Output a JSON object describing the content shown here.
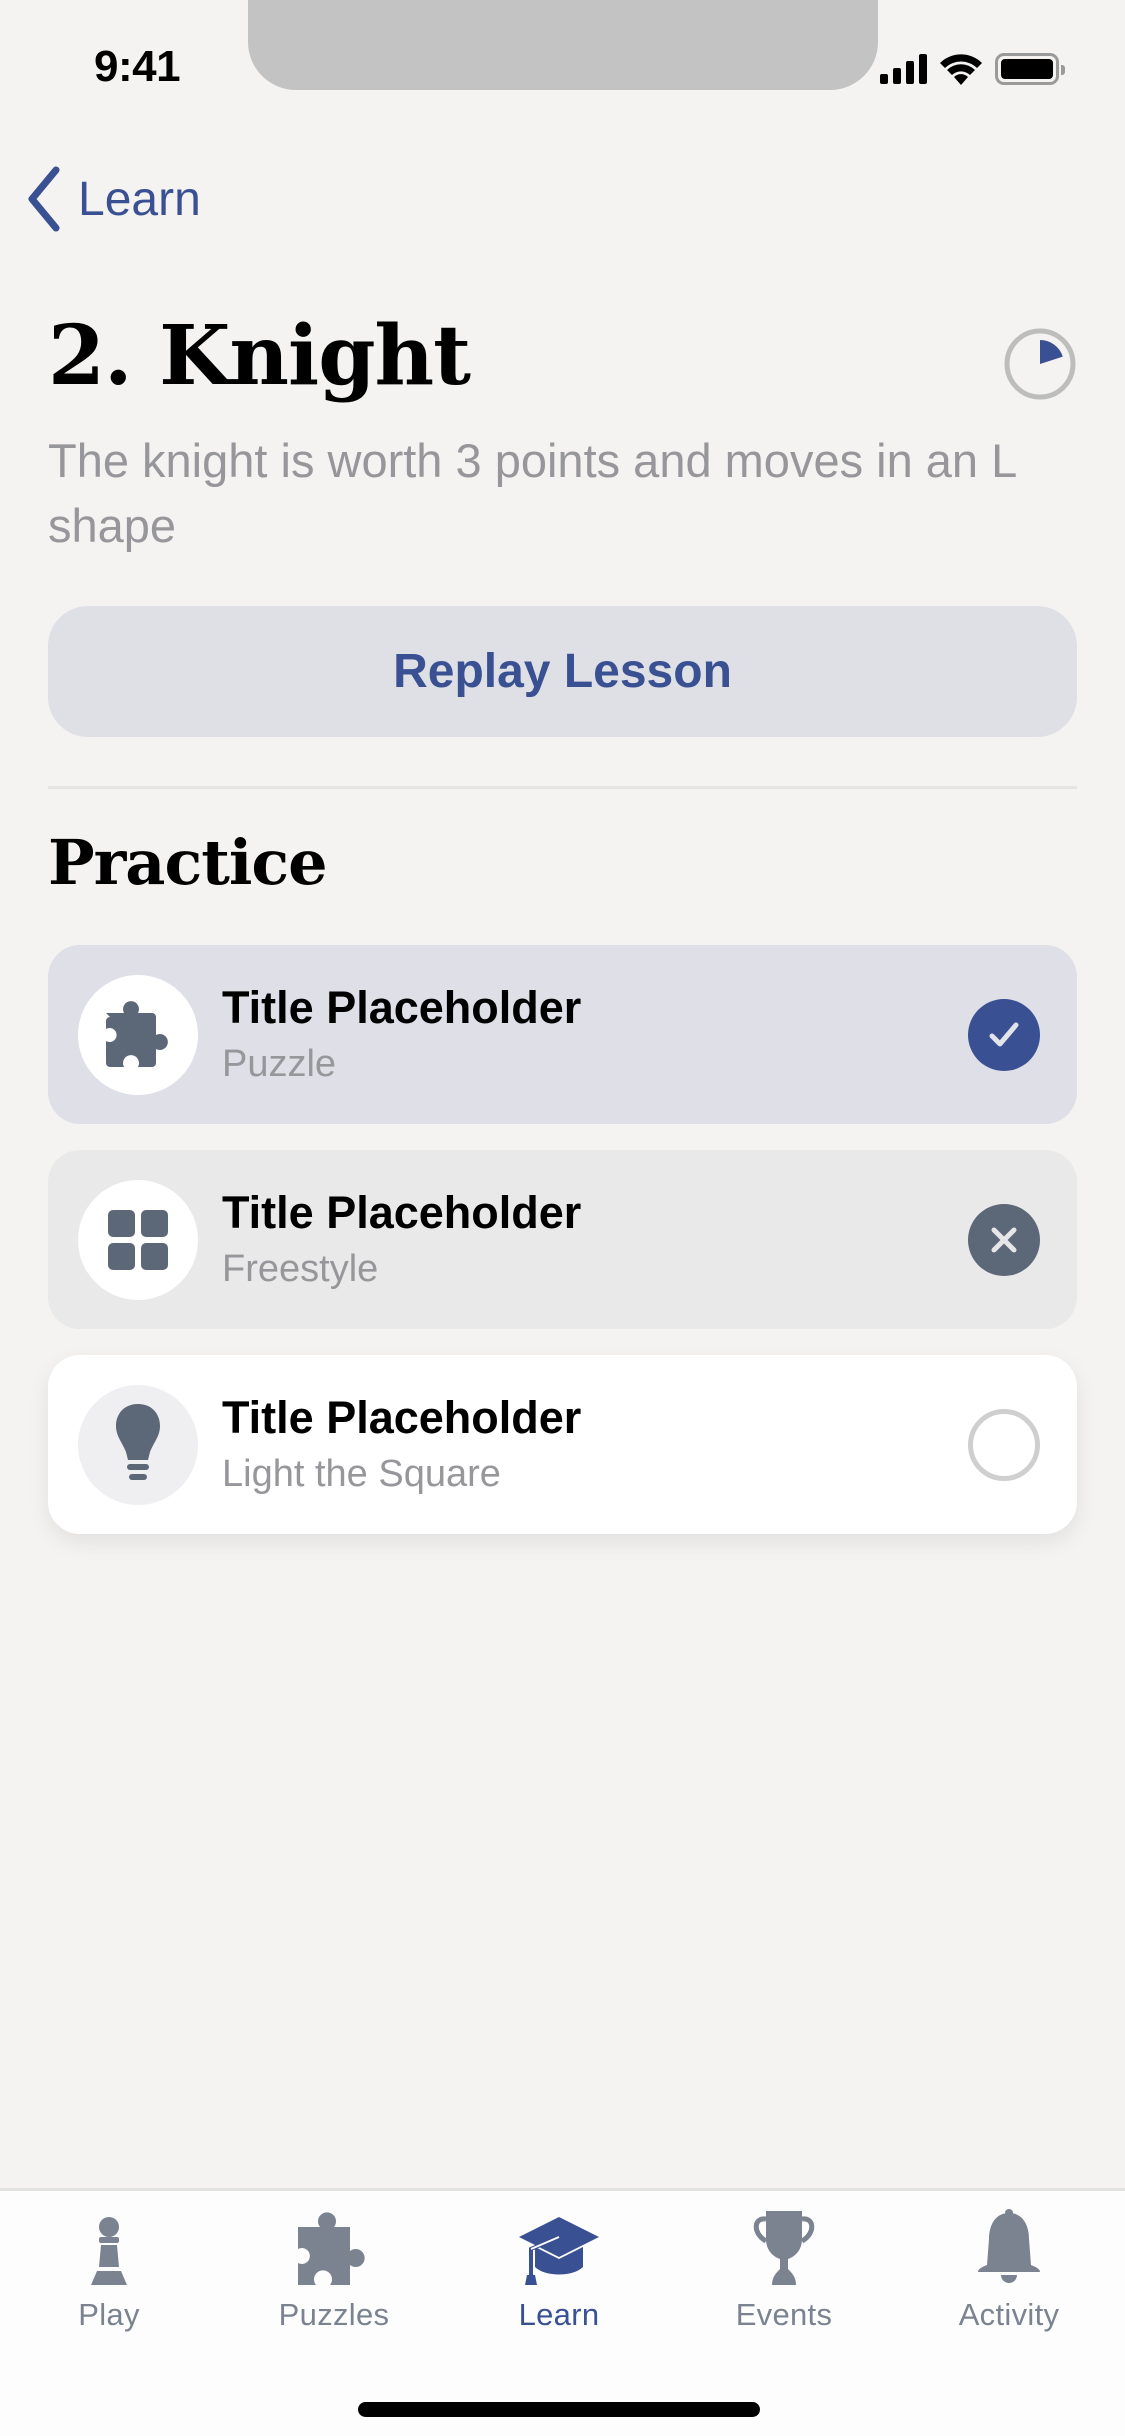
{
  "status_bar": {
    "time": "9:41",
    "icons": [
      "cellular-signal-icon",
      "wifi-icon",
      "battery-icon"
    ]
  },
  "nav": {
    "back_label": "Learn",
    "back_icon": "chevron-left-icon"
  },
  "lesson": {
    "title": "2. Knight",
    "description": "The knight is worth 3 points and moves in an L shape",
    "progress_fraction": 0.2,
    "replay_label": "Replay Lesson"
  },
  "colors": {
    "accent": "#395192",
    "background": "#f4f3f1",
    "icon_gray": "#5c6778",
    "tab_inactive": "#7b8391"
  },
  "practice": {
    "heading": "Practice",
    "items": [
      {
        "title": "Title Placeholder",
        "subtitle": "Puzzle",
        "icon": "puzzle-piece-icon",
        "status": "completed",
        "status_icon": "checkmark-icon"
      },
      {
        "title": "Title Placeholder",
        "subtitle": "Freestyle",
        "icon": "grid-icon",
        "status": "failed",
        "status_icon": "x-mark-icon"
      },
      {
        "title": "Title Placeholder",
        "subtitle": "Light the Square",
        "icon": "lightbulb-icon",
        "status": "not-started",
        "status_icon": "empty-circle-icon"
      }
    ]
  },
  "tabbar": {
    "active": "Learn",
    "tabs": [
      {
        "label": "Play",
        "icon": "pawn-icon"
      },
      {
        "label": "Puzzles",
        "icon": "puzzle-piece-icon"
      },
      {
        "label": "Learn",
        "icon": "graduation-cap-icon"
      },
      {
        "label": "Events",
        "icon": "trophy-icon"
      },
      {
        "label": "Activity",
        "icon": "bell-icon"
      }
    ]
  }
}
